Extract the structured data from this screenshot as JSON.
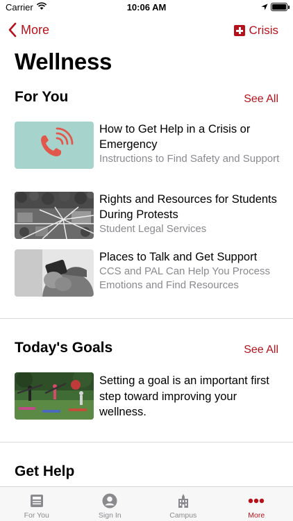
{
  "status_bar": {
    "carrier": "Carrier",
    "time": "10:06 AM"
  },
  "nav": {
    "back_label": "More",
    "crisis_label": "Crisis"
  },
  "page": {
    "title": "Wellness"
  },
  "for_you": {
    "title": "For You",
    "see_all": "See All",
    "items": [
      {
        "title": "How to Get Help in a Crisis or Emergency",
        "subtitle": "Instructions to Find Safety and Support",
        "thumb": "phone-icon"
      },
      {
        "title": "Rights and Resources for Students During Protests",
        "subtitle": "Student Legal Services",
        "thumb": "campus-aerial-photo"
      },
      {
        "title": "Places to Talk and Get Support",
        "subtitle": "CCS and PAL Can Help You Process Emotions and Find Resources",
        "thumb": "person-holding-phone-photo"
      }
    ]
  },
  "goals": {
    "title": "Today's Goals",
    "see_all": "See All",
    "text": "Setting a goal is an important first step toward improving your wellness.",
    "thumb": "outdoor-yoga-photo"
  },
  "get_help": {
    "title": "Get Help"
  },
  "tabs": [
    {
      "label": "For You",
      "icon": "newspaper-icon"
    },
    {
      "label": "Sign In",
      "icon": "person-icon"
    },
    {
      "label": "Campus",
      "icon": "building-icon"
    },
    {
      "label": "More",
      "icon": "more-dots-icon",
      "active": true
    }
  ],
  "colors": {
    "accent": "#b5121b",
    "thumb_teal": "#a6d3cc",
    "phone_red": "#e2574c"
  }
}
